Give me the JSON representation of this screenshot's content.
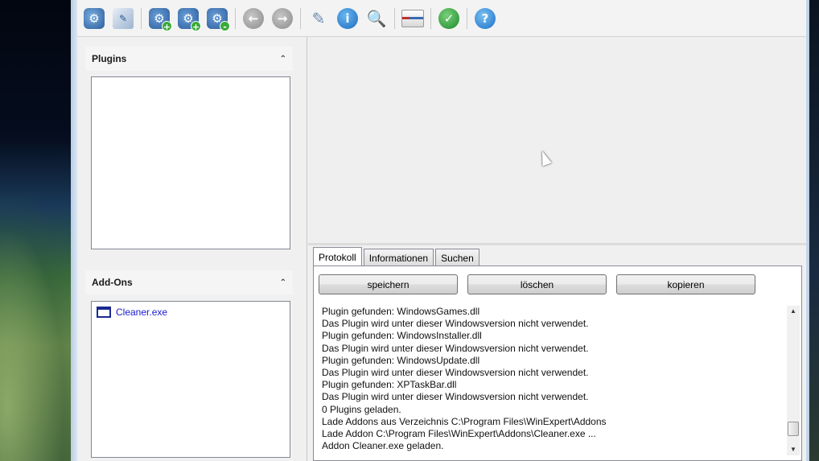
{
  "toolbar": {
    "buttons": [
      {
        "name": "settings-gear-icon",
        "glyph": "⚙"
      },
      {
        "name": "edit-document-icon",
        "glyph": "✎"
      },
      {
        "name": "add-plugin-icon",
        "glyph": "⚙"
      },
      {
        "name": "add-plugin-2-icon",
        "glyph": "⚙"
      },
      {
        "name": "add-plugin-3-icon",
        "glyph": "⚙"
      },
      {
        "name": "back-arrow-icon",
        "glyph": "←"
      },
      {
        "name": "forward-arrow-icon",
        "glyph": "→"
      },
      {
        "name": "pen-icon",
        "glyph": "✎"
      },
      {
        "name": "info-icon",
        "glyph": "i"
      },
      {
        "name": "search-magnifier-icon",
        "glyph": "🔍"
      },
      {
        "name": "list-view-icon",
        "glyph": ""
      },
      {
        "name": "green-tool-icon",
        "glyph": "✓"
      },
      {
        "name": "help-icon",
        "glyph": "?"
      }
    ]
  },
  "left": {
    "plugins": {
      "title": "Plugins",
      "collapse_glyph": "⌃"
    },
    "addons": {
      "title": "Add-Ons",
      "collapse_glyph": "⌃",
      "items": [
        {
          "label": "Cleaner.exe"
        }
      ]
    }
  },
  "bottom": {
    "tabs": [
      {
        "label": "Protokoll",
        "active": true
      },
      {
        "label": "Informationen",
        "active": false
      },
      {
        "label": "Suchen",
        "active": false
      }
    ],
    "buttons": {
      "save": "speichern",
      "delete": "löschen",
      "copy": "kopieren"
    },
    "log_lines": [
      "Plugin gefunden: WindowsGames.dll",
      "Das Plugin wird unter dieser Windowsversion nicht verwendet.",
      "Plugin gefunden: WindowsInstaller.dll",
      "Das Plugin wird unter dieser Windowsversion nicht verwendet.",
      "Plugin gefunden: WindowsUpdate.dll",
      "Das Plugin wird unter dieser Windowsversion nicht verwendet.",
      "Plugin gefunden: XPTaskBar.dll",
      "Das Plugin wird unter dieser Windowsversion nicht verwendet.",
      "0 Plugins geladen.",
      "Lade Addons aus Verzeichnis C:\\Program Files\\WinExpert\\Addons",
      "Lade Addon C:\\Program Files\\WinExpert\\Addons\\Cleaner.exe ...",
      "Addon Cleaner.exe geladen."
    ],
    "scroll": {
      "up": "▲",
      "down": "▼"
    }
  }
}
